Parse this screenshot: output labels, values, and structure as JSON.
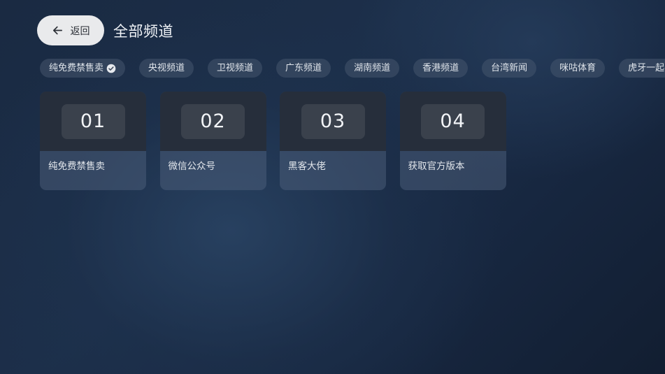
{
  "header": {
    "back_label": "返回",
    "title": "全部频道"
  },
  "tabs": [
    {
      "label": "纯免费禁售卖",
      "selected": true
    },
    {
      "label": "央视频道"
    },
    {
      "label": "卫视频道"
    },
    {
      "label": "广东频道"
    },
    {
      "label": "湖南频道"
    },
    {
      "label": "香港频道"
    },
    {
      "label": "台湾新闻"
    },
    {
      "label": "咪咕体育"
    },
    {
      "label": "虎牙一起"
    }
  ],
  "channels": [
    {
      "number": "01",
      "name": "纯免费禁售卖"
    },
    {
      "number": "02",
      "name": "微信公众号"
    },
    {
      "number": "03",
      "name": "黑客大佬"
    },
    {
      "number": "04",
      "name": "获取官方版本"
    }
  ],
  "colors": {
    "background": "#1c2f4a",
    "card_top": "#262e3b",
    "chip_bg": "#46566e",
    "back_button": "#e9eaec"
  },
  "icons": {
    "back": "arrow-left-icon",
    "selected": "check-circle-icon"
  }
}
